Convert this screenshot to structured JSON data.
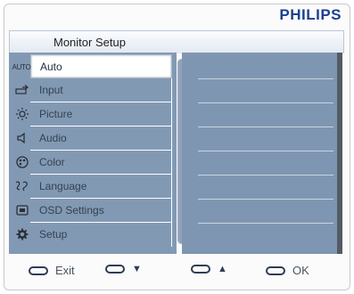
{
  "brand": "PHILIPS",
  "title": "Monitor Setup",
  "menu": {
    "items": [
      {
        "icon": "auto-icon",
        "icon_text": "AUTO",
        "label": "Auto"
      },
      {
        "icon": "input-icon",
        "label": "Input"
      },
      {
        "icon": "picture-icon",
        "label": "Picture"
      },
      {
        "icon": "audio-icon",
        "label": "Audio"
      },
      {
        "icon": "color-icon",
        "label": "Color"
      },
      {
        "icon": "language-icon",
        "label": "Language"
      },
      {
        "icon": "osd-settings-icon",
        "label": "OSD Settings"
      },
      {
        "icon": "setup-icon",
        "label": "Setup"
      }
    ],
    "selected_index": 0
  },
  "footer": {
    "exit_label": "Exit",
    "ok_label": "OK"
  },
  "colors": {
    "brand": "#1b3f8f",
    "menu_bg": "#8299b4",
    "selected_bg": "#ffffff"
  }
}
